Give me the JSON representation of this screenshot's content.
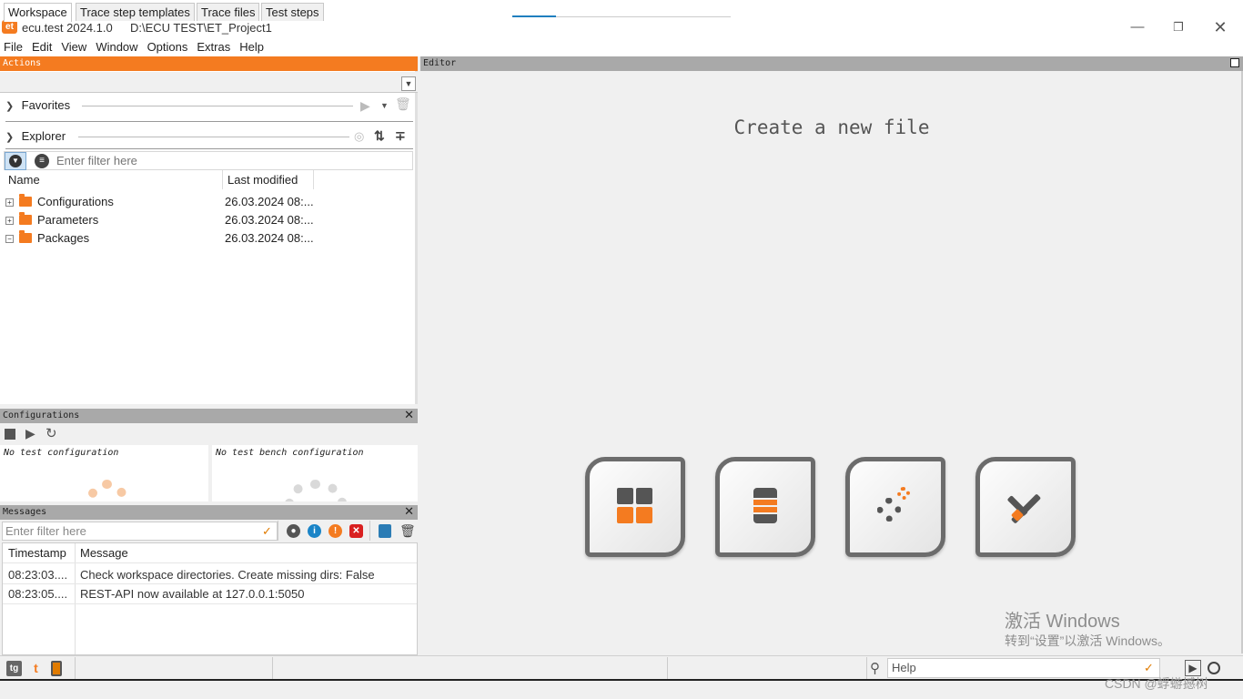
{
  "window": {
    "app_title": "ecu.test 2024.1.0",
    "app_icon_text": "et",
    "project_path": "D:\\ECU TEST\\ET_Project1"
  },
  "menu": [
    "File",
    "Edit",
    "View",
    "Window",
    "Options",
    "Extras",
    "Help"
  ],
  "actions": {
    "header": "Actions",
    "tabs": [
      "Workspace",
      "Trace step templates",
      "Trace files",
      "Test steps"
    ],
    "active_tab": "Workspace",
    "favorites_label": "Favorites",
    "explorer_label": "Explorer",
    "filter_placeholder": "Enter filter here",
    "columns": [
      "Name",
      "Last modified"
    ],
    "tree": [
      {
        "name": "Configurations",
        "modified": "26.03.2024 08:...",
        "expanded": false
      },
      {
        "name": "Parameters",
        "modified": "26.03.2024 08:...",
        "expanded": false
      },
      {
        "name": "Packages",
        "modified": "26.03.2024 08:...",
        "expanded": true
      }
    ]
  },
  "configurations": {
    "header": "Configurations",
    "test_config": "No test configuration",
    "bench_config": "No test bench configuration"
  },
  "messages": {
    "header": "Messages",
    "filter_placeholder": "Enter filter here",
    "columns": [
      "Timestamp",
      "Message"
    ],
    "rows": [
      {
        "timestamp": "08:23:03....",
        "message": "Check workspace directories. Create missing dirs: False"
      },
      {
        "timestamp": "08:23:05....",
        "message": "REST-API now available at 127.0.0.1:5050"
      }
    ]
  },
  "editor": {
    "header": "Editor",
    "title": "Create a new file",
    "tiles": [
      "package-icon",
      "parameter-icon",
      "configuration-gears-icon",
      "tools-icon"
    ]
  },
  "watermark": {
    "line1": "激活 Windows",
    "line2": "转到“设置”以激活 Windows。"
  },
  "statusbar": {
    "help_placeholder": "Help",
    "icons": [
      "tg-icon",
      "tms-icon",
      "device-icon"
    ]
  },
  "footer": {
    "credit": "CSDN @蜉蝣撼树"
  },
  "colors": {
    "accent": "#f47b20",
    "panel_head": "#a9a9a9"
  }
}
